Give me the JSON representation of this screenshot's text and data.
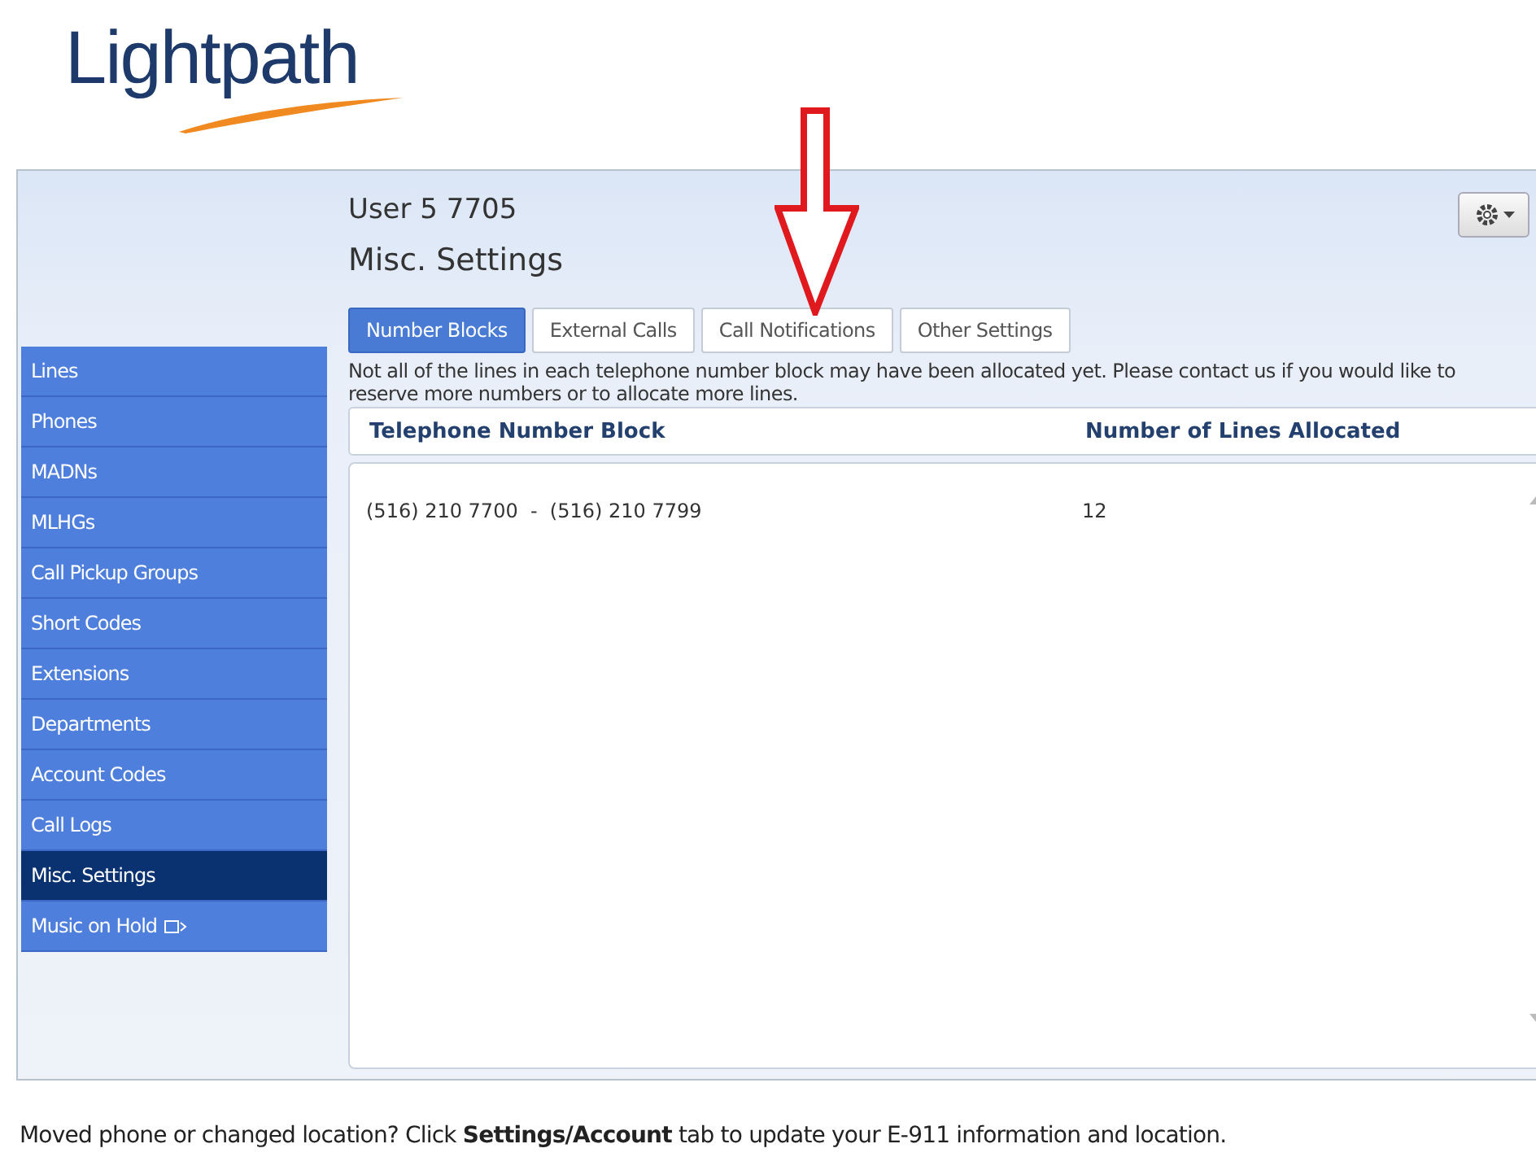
{
  "logo": {
    "text": "Lightpath"
  },
  "header": {
    "user": "User 5 7705",
    "title": "Misc. Settings"
  },
  "sidebar": {
    "items": [
      {
        "label": "Lines",
        "selected": false,
        "external": false
      },
      {
        "label": "Phones",
        "selected": false,
        "external": false
      },
      {
        "label": "MADNs",
        "selected": false,
        "external": false
      },
      {
        "label": "MLHGs",
        "selected": false,
        "external": false
      },
      {
        "label": "Call Pickup Groups",
        "selected": false,
        "external": false
      },
      {
        "label": "Short Codes",
        "selected": false,
        "external": false
      },
      {
        "label": "Extensions",
        "selected": false,
        "external": false
      },
      {
        "label": "Departments",
        "selected": false,
        "external": false
      },
      {
        "label": "Account Codes",
        "selected": false,
        "external": false
      },
      {
        "label": "Call Logs",
        "selected": false,
        "external": false
      },
      {
        "label": "Misc. Settings",
        "selected": true,
        "external": false
      },
      {
        "label": "Music on Hold",
        "selected": false,
        "external": true
      }
    ]
  },
  "tabs": [
    {
      "label": "Number Blocks",
      "selected": true
    },
    {
      "label": "External Calls",
      "selected": false
    },
    {
      "label": "Call Notifications",
      "selected": false
    },
    {
      "label": "Other Settings",
      "selected": false
    }
  ],
  "intro": "Not all of the lines in each telephone number block may have been allocated yet. Please contact us if you would like to reserve more numbers or to allocate more lines.",
  "table": {
    "columns": [
      "Telephone Number Block",
      "Number of Lines Allocated"
    ],
    "rows": [
      [
        "(516) 210 7700  -  (516) 210 7799",
        "12"
      ]
    ]
  },
  "footer": "Moved phone or changed location? Click **Settings/Account** tab to update your E-911 information and location."
}
